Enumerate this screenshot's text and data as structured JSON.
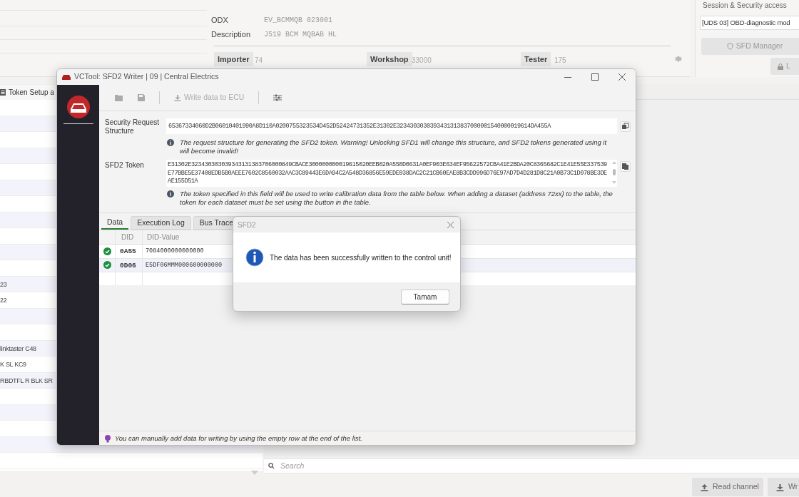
{
  "background_app": {
    "info": {
      "odx_label": "ODX",
      "odx": "EV_BCMMQB 023001",
      "description_label": "Description",
      "description": "J519 BCM MQBAB HL",
      "fields": [
        {
          "label": "Importer",
          "value": "74"
        },
        {
          "label": "Workshop",
          "value": "33000"
        },
        {
          "label": "Tester",
          "value": "175"
        }
      ]
    },
    "session": {
      "title": "Session & Security access",
      "mode": "[UDS 03] OBD-diagnostic mod",
      "buttons": [
        "SFD Manager",
        "L"
      ]
    },
    "tab": "Token Setup a",
    "list_rows": [
      "23",
      "22",
      "linktaster C48",
      "K SL KC9",
      "RBDTFL R BLK SR"
    ],
    "search": {
      "placeholder": "Search"
    },
    "bottom_buttons": [
      {
        "kind": "upload",
        "label": "Read channel"
      },
      {
        "kind": "download",
        "label": "Wr"
      }
    ]
  },
  "window": {
    "title": "VCTool: SFD2 Writer | 09 | Central Electrics",
    "toolbar": {
      "write_button": {
        "label": "Write data to ECU",
        "disabled": true
      }
    },
    "security_request": {
      "label": "Security Request Structure",
      "value": "65367334060D2B06010401990A8D110A0200755323534D452D52424731352E31302E3234303030393431313837000001540000019614DA455A",
      "info": "The request structure for generating the SFD2 token. Warning! Unlocking SFD1 will change this structure, and SFD2 tokens generated using it will become invalid!"
    },
    "token": {
      "label": "SFD2 Token",
      "value": "E31302E323430303039343131383706000849CBACE300000000019615020EEB020A550D0631A0EF903E634EF95622572CBA41E2BDA20C8365682C1E41E55E337539E77BBE5E37408EDB5B0AEEE7602C8560032AAC3C89443E6DA94C2A548D36856E59EDE038DAC2C21CB60EAE8B3CDD996D76E97AD7D4D281D8C21A0B73C1D078BE3DEAE155D51A",
      "info": "The token specified in this field will be used to write calibration data from the table below. When adding a dataset (address 72xx) to the table, the token for each dataset must be set using the button in the table."
    },
    "tabs": [
      {
        "label": "Data",
        "selected": true
      },
      {
        "label": "Execution Log",
        "selected": false
      },
      {
        "label": "Bus Trace",
        "selected": false
      }
    ],
    "table": {
      "columns": [
        "DID",
        "DID-Value"
      ],
      "rows": [
        {
          "ok": true,
          "did": "0A55",
          "value": "7084000000000000"
        },
        {
          "ok": true,
          "did": "0D06",
          "value": "E5DF06MMM000600000000"
        }
      ]
    },
    "tip": "You can manually add data for writing by using the empty row at the end of the list."
  },
  "message_box": {
    "title": "SFD2",
    "message": "The data has been successfully written to the control unit!",
    "button": "Tamam"
  }
}
